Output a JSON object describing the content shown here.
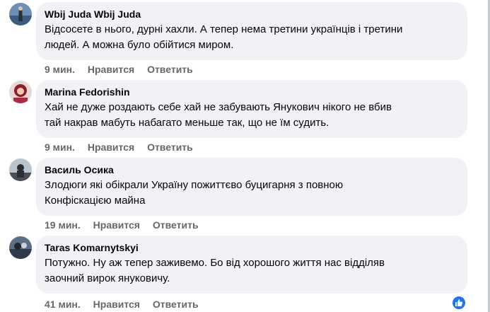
{
  "comments": [
    {
      "author": "Wbij Juda Wbij Juda",
      "lines": [
        "Відсосете в нього, дурні хахли. А тепер нема третини українців і третини",
        "людей. А можна було обійтися миром."
      ],
      "time": "9 мин.",
      "like": "Нравится",
      "reply": "Ответить"
    },
    {
      "author": "Marina Fedorishin",
      "lines": [
        "Хай не дуже роздають себе хай не забувають Янукович нікого не вбив",
        "тай накрав мабуть набагато меньше так, що не їм судить."
      ],
      "time": "9 мин.",
      "like": "Нравится",
      "reply": "Ответить"
    },
    {
      "author": "Василь Осика",
      "lines": [
        "Злодюги які обікрали Україну пожиттєво буцигарня з повною",
        "Конфіскацією майна"
      ],
      "time": "19 мин.",
      "like": "Нравится",
      "reply": "Ответить"
    },
    {
      "author": "Taras Komarnytskyi",
      "lines": [
        "Потужно. Ну аж тепер заживемо. Бо від хорошого життя нас відділяв",
        "заочний вирок януковичу."
      ],
      "time": "41 мин.",
      "like": "Нравится",
      "reply": "Ответить"
    }
  ],
  "reaction_icon": "like-thumb-icon",
  "colors": {
    "bubble": "#f0f2f5",
    "meta": "#65676b",
    "text": "#050505",
    "like_badge": "#1877f2"
  }
}
